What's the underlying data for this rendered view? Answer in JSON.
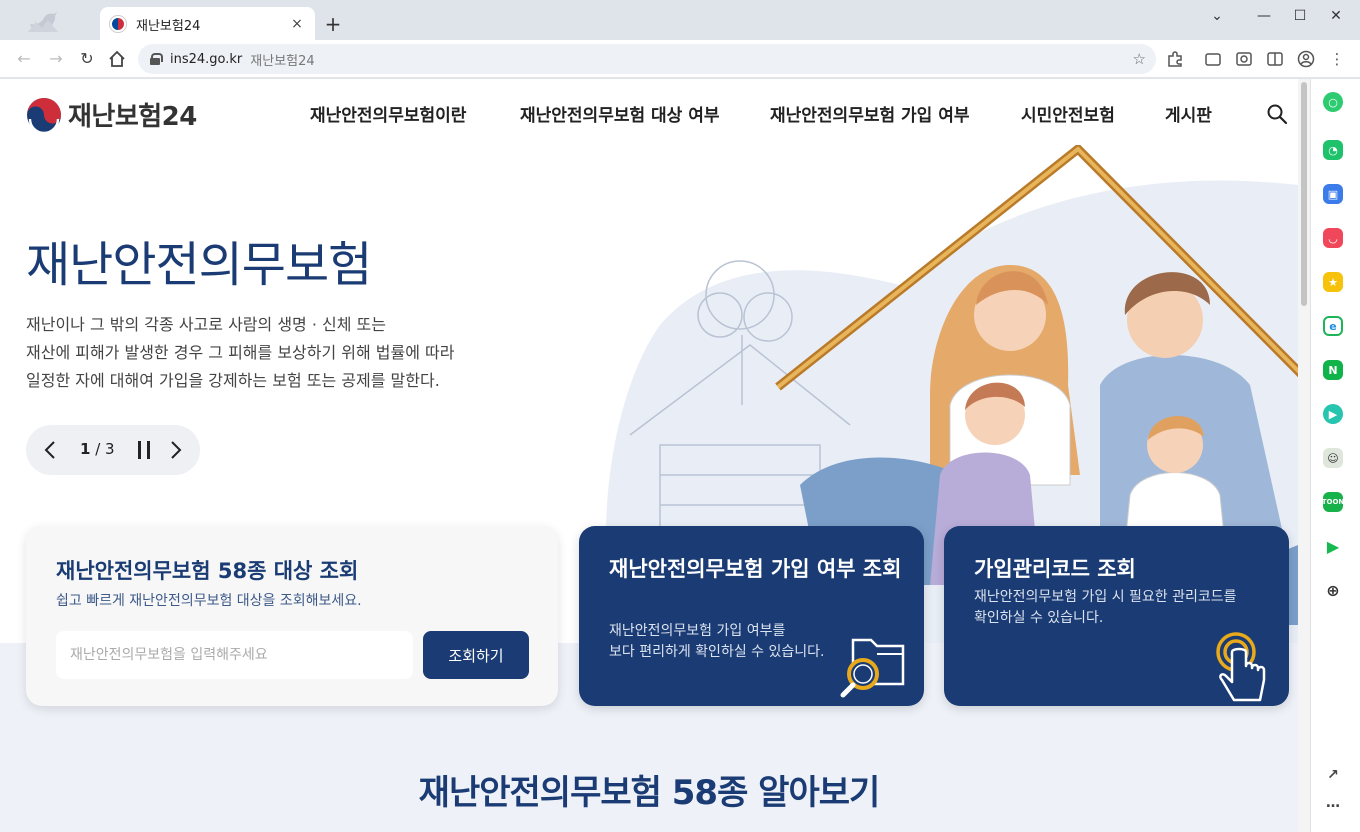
{
  "browser": {
    "tab_title": "재난보험24",
    "tab_close": "×",
    "new_tab": "+",
    "url": "ins24.go.kr",
    "url_page_title": "재난보험24",
    "minimize": "—",
    "maximize": "☐",
    "close": "✕",
    "tab_list": "⌄"
  },
  "header": {
    "logo_text": "재난보험24",
    "nav": [
      "재난안전의무보험이란",
      "재난안전의무보험 대상 여부",
      "재난안전의무보험 가입 여부",
      "시민안전보험",
      "게시판"
    ]
  },
  "hero": {
    "title": "재난안전의무보험",
    "desc": [
      "재난이나 그 밖의 각종 사고로 사람의 생명 · 신체 또는",
      "재산에 피해가 발생한 경우 그 피해를 보상하기 위해 법률에 따라",
      "일정한 자에 대해여 가입을 강제하는 보험 또는 공제를 말한다."
    ],
    "slider_current": "1",
    "slider_total": " / 3",
    "slide_progress": 0.333
  },
  "card1": {
    "title": "재난안전의무보험 58종 대상 조회",
    "subtitle": "쉽고 빠르게 재난안전의무보험 대상을 조회해보세요.",
    "placeholder": "재난안전의무보험을 입력해주세요",
    "button": "조회하기"
  },
  "card2": {
    "title": "재난안전의무보험 가입 여부 조회",
    "desc": [
      "재난안전의무보험 가입 여부를",
      "보다 편리하게 확인하실 수 있습니다."
    ]
  },
  "card3": {
    "title": "가입관리코드 조회",
    "desc": [
      "재난안전의무보험 가입 시 필요한 관리코드를",
      "확인하실 수 있습니다."
    ]
  },
  "section": {
    "title": "재난안전의무보험 58종 알아보기"
  },
  "colors": {
    "brand_navy": "#1a3b73",
    "band_bg": "#eef2f8",
    "accent_gold": "#e8a91a"
  }
}
